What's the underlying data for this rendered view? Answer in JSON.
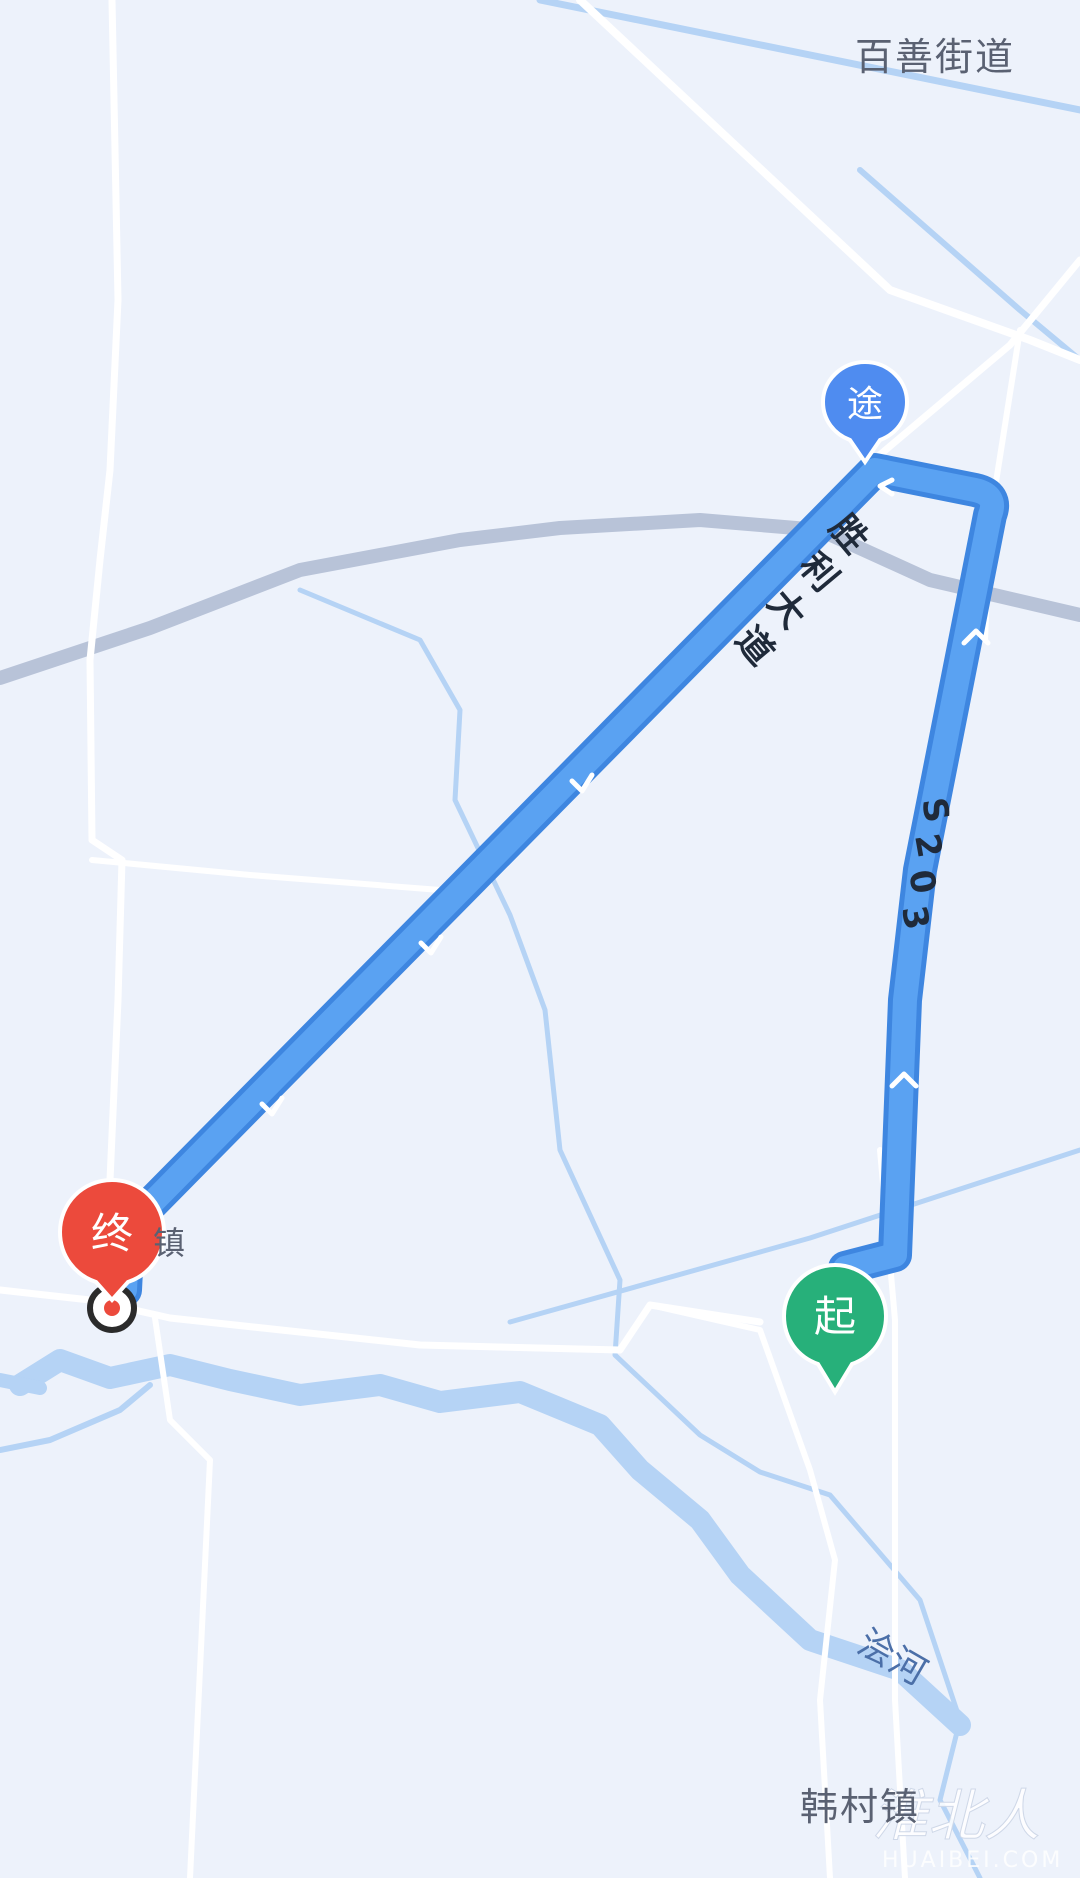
{
  "places": {
    "baishan": "百善街道",
    "hancun": "韩村镇",
    "end_town_partial": "镇"
  },
  "roads": {
    "shengli": [
      "胜",
      "利",
      "大",
      "道"
    ],
    "s203": [
      "S",
      "2",
      "0",
      "3"
    ]
  },
  "river": {
    "name": "浍河"
  },
  "markers": {
    "start": "起",
    "waypoint": "途",
    "end": "终"
  },
  "watermark": {
    "text": "淮北人",
    "url": "HUAIBEI.COM"
  },
  "colors": {
    "background": "#edf2fb",
    "route": "#5aa2f2",
    "route_edge": "#3e86e0",
    "water": "#b5d3f5",
    "road": "#ffffff",
    "rail": "#b8c3d8",
    "start_pin": "#27b07a",
    "waypoint_pin": "#4f8cf0",
    "end_pin": "#ec4a3c"
  }
}
